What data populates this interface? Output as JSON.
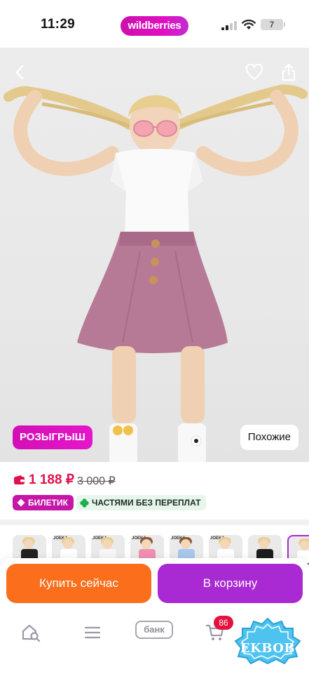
{
  "status_bar": {
    "time": "11:29",
    "brand": "wildberries",
    "battery": "7"
  },
  "hero": {
    "raffle_label": "РОЗЫГРЫШ",
    "similar_label": "Похожие"
  },
  "price": {
    "current": "1 188 ₽",
    "old": "3 000 ₽",
    "ticket_badge": "БИЛЕТИК",
    "installments_badge": "ЧАСТЯМИ БЕЗ ПЕРЕПЛАТ"
  },
  "thumbnails": {
    "count_shown": 8,
    "brand_tag": "JOEKA"
  },
  "actions": {
    "buy_now": "Купить сейчас",
    "add_to_cart": "В корзину"
  },
  "bottom_nav": {
    "bank_label": "банк",
    "cart_count": "86"
  },
  "watermark": "EKBOB",
  "colors": {
    "brand_gradient_start": "#cb11ab",
    "price_red": "#e0114d",
    "buy_now_orange": "#fb6f1c",
    "cart_purple": "#a929d3",
    "badge_magenta": "#c516a7",
    "badge_green_bg": "#e7f6ec"
  }
}
